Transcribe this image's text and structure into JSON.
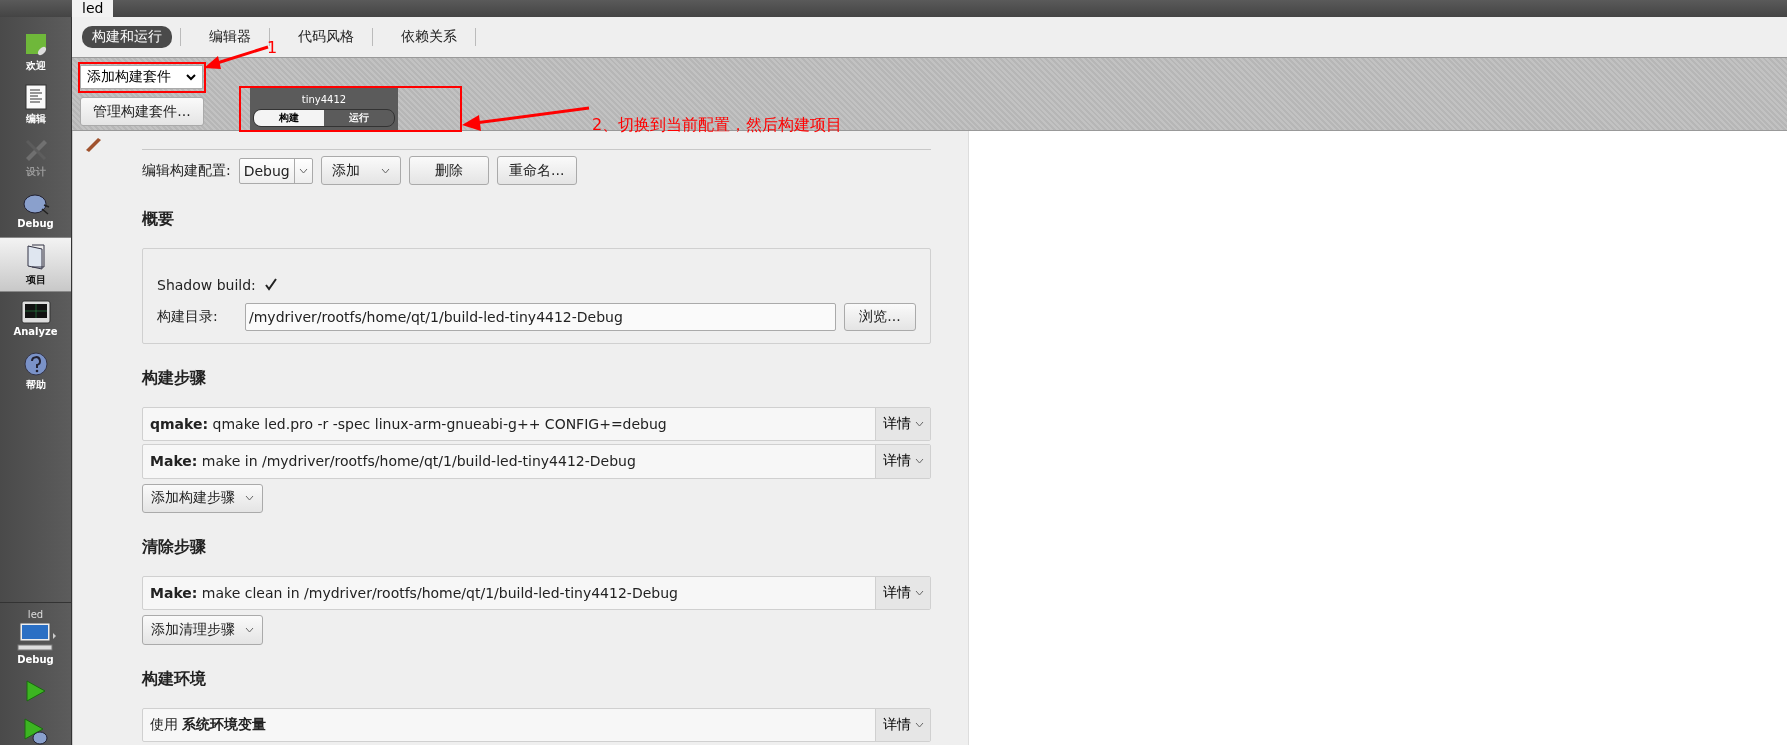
{
  "project_tab": {
    "label": "led"
  },
  "sidebar": {
    "items": [
      {
        "kind": "welcome",
        "label": "欢迎",
        "selected": false,
        "disabled": false
      },
      {
        "kind": "edit",
        "label": "编辑",
        "selected": false,
        "disabled": false
      },
      {
        "kind": "design",
        "label": "设计",
        "selected": false,
        "disabled": true
      },
      {
        "kind": "debug",
        "label": "Debug",
        "selected": false,
        "disabled": false
      },
      {
        "kind": "projects",
        "label": "项目",
        "selected": true,
        "disabled": false
      },
      {
        "kind": "analyze",
        "label": "Analyze",
        "selected": false,
        "disabled": false
      },
      {
        "kind": "help",
        "label": "帮助",
        "selected": false,
        "disabled": false
      }
    ],
    "target": {
      "project": "led",
      "config": "Debug"
    }
  },
  "subtabs": [
    {
      "label": "构建和运行",
      "selected": true
    },
    {
      "label": "编辑器",
      "selected": false
    },
    {
      "label": "代码风格",
      "selected": false
    },
    {
      "label": "依赖关系",
      "selected": false
    }
  ],
  "kit_selector": {
    "value": "添加构建套件"
  },
  "manage_kits_button": "管理构建套件...",
  "target_popup": {
    "kit": "tiny4412",
    "modes": [
      {
        "label": "构建",
        "selected": true
      },
      {
        "label": "运行",
        "selected": false
      }
    ]
  },
  "build_config": {
    "label": "编辑构建配置:",
    "value": "Debug",
    "add_button": "添加",
    "delete_button": "删除",
    "rename_button": "重命名..."
  },
  "sections": [
    {
      "kind": "general",
      "title": "概要",
      "shadow_build": {
        "label": "Shadow build:",
        "checked": true
      },
      "build_dir": {
        "label": "构建目录:",
        "value": "/mydriver/rootfs/home/qt/1/build-led-tiny4412-Debug",
        "browse_button": "浏览..."
      }
    },
    {
      "kind": "steps",
      "title": "构建步骤",
      "rows": [
        {
          "text": "**qmake:** qmake led.pro -r -spec linux-arm-gnueabi-g++ CONFIG+=debug",
          "details": "详情"
        },
        {
          "text": "**Make:** make in /mydriver/rootfs/home/qt/1/build-led-tiny4412-Debug",
          "details": "详情"
        }
      ],
      "add_button": "添加构建步骤"
    },
    {
      "kind": "steps",
      "title": "清除步骤",
      "rows": [
        {
          "text": "**Make:** make clean in /mydriver/rootfs/home/qt/1/build-led-tiny4412-Debug",
          "details": "详情"
        }
      ],
      "add_button": "添加清理步骤"
    },
    {
      "kind": "steps",
      "title": "构建环境",
      "rows": [
        {
          "text": "使用 **系统环境变量**",
          "details": "详情"
        }
      ]
    }
  ],
  "annotations": [
    {
      "kind": "step-1",
      "text": "1"
    },
    {
      "kind": "step-2",
      "text": "2、切换到当前配置，然后构建项目"
    }
  ]
}
